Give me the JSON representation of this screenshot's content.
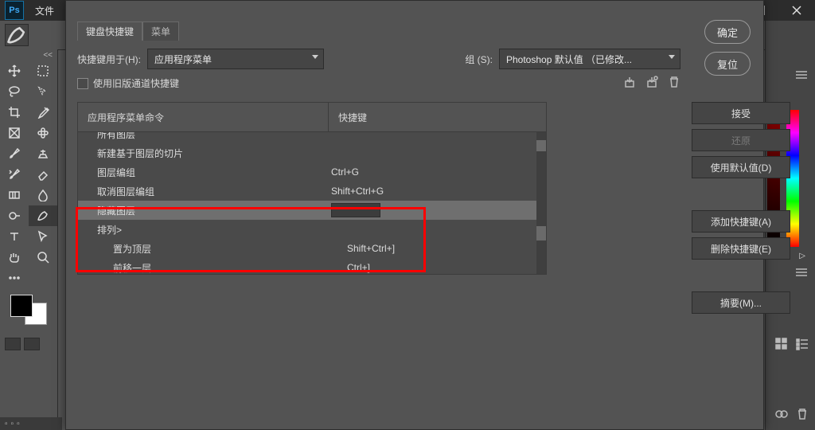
{
  "menubar": {
    "file": "文件"
  },
  "dialog": {
    "tabs": {
      "keyboard": "键盘快捷键",
      "menus": "菜单"
    },
    "shortcut_for_label": "快捷键用于(H):",
    "shortcut_for_value": "应用程序菜单",
    "set_label": "组 (S):",
    "set_value": "Photoshop 默认值 （已修改...",
    "legacy_channels": "使用旧版通道快捷键",
    "headers": {
      "command": "应用程序菜单命令",
      "shortcut": "快捷键"
    },
    "rows": [
      {
        "cmd": "所有图层",
        "sc": "",
        "indent": 1,
        "clip": true
      },
      {
        "cmd": "新建基于图层的切片",
        "sc": "",
        "indent": 1
      },
      {
        "cmd": "图层编组",
        "sc": "Ctrl+G",
        "indent": 1
      },
      {
        "cmd": "取消图层编组",
        "sc": "Shift+Ctrl+G",
        "indent": 1
      },
      {
        "cmd": "隐藏图层",
        "sc": "",
        "indent": 1,
        "selected": true
      },
      {
        "cmd": "排列>",
        "sc": "",
        "indent": 1
      },
      {
        "cmd": "置为顶层",
        "sc": "Shift+Ctrl+]",
        "indent": 2
      },
      {
        "cmd": "前移一层",
        "sc": "Ctrl+]",
        "indent": 2,
        "clip": true
      }
    ],
    "ok": "确定",
    "reset": "复位",
    "accept": "接受",
    "undo": "还原",
    "use_default": "使用默认值(D)",
    "add_shortcut": "添加快捷键(A)",
    "delete_shortcut": "删除快捷键(E)",
    "summarize": "摘要(M)..."
  },
  "left_tools_tab": "<<",
  "bottom_rep": "▫▫▫",
  "icon_tri": "▷"
}
